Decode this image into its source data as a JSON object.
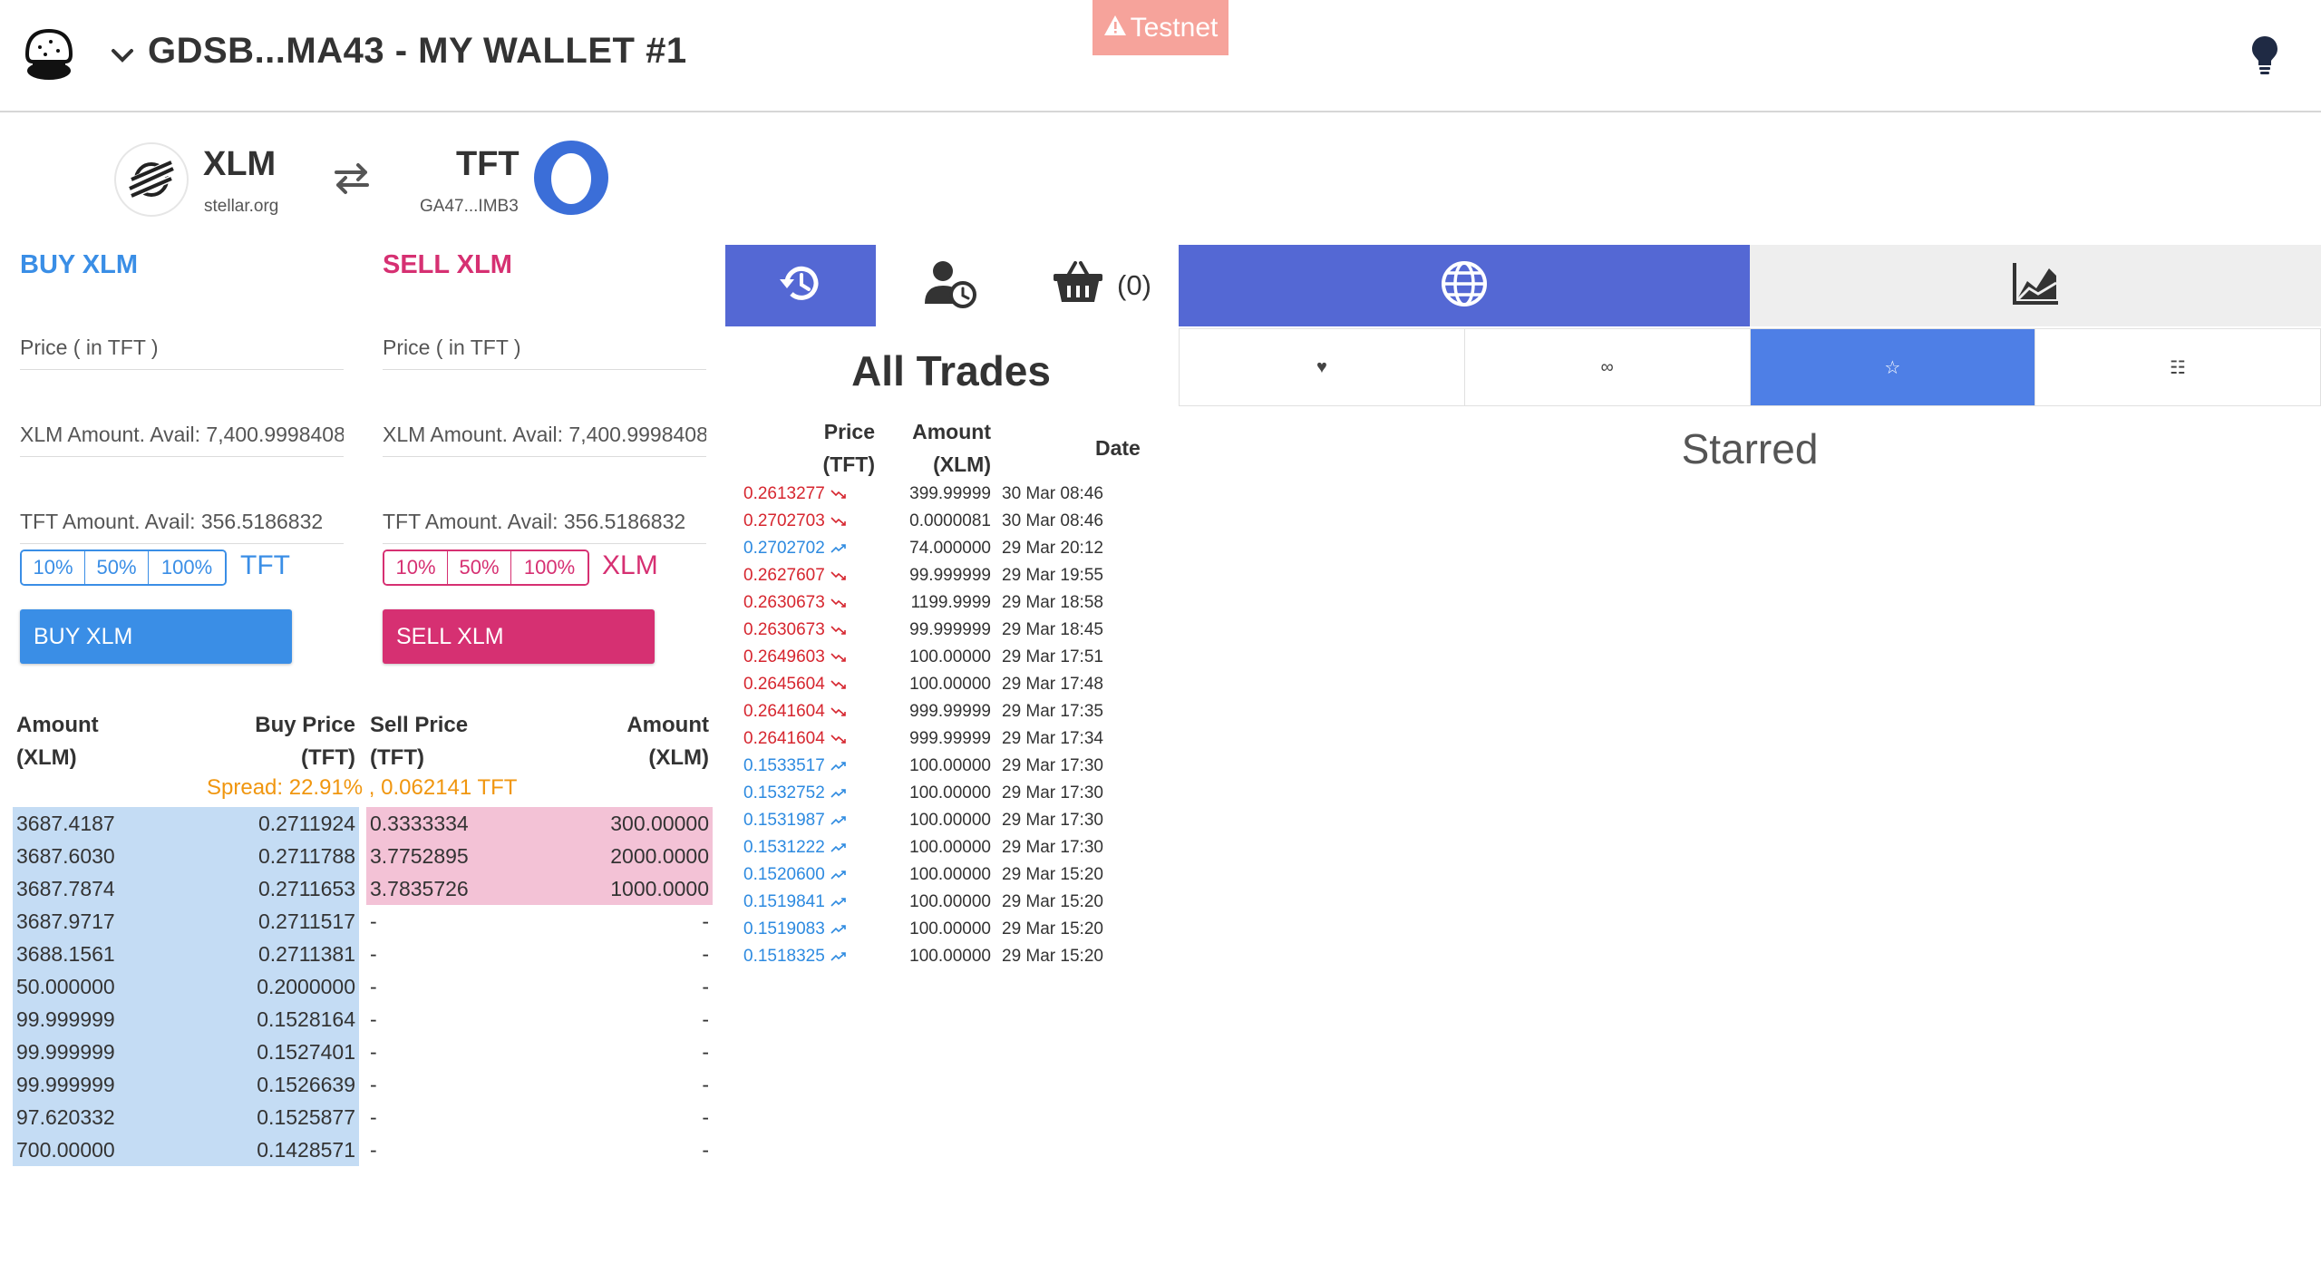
{
  "header": {
    "wallet_title": "GDSB...MA43 - MY WALLET #1",
    "testnet_label": "Testnet"
  },
  "pair": {
    "base": {
      "code": "XLM",
      "domain": "stellar.org"
    },
    "counter": {
      "code": "TFT",
      "issuer": "GA47...IMB3"
    }
  },
  "buy": {
    "title": "BUY XLM",
    "price_placeholder": "Price ( in TFT )",
    "amount_placeholder": "XLM Amount. Avail: 7,400.9998408",
    "total_placeholder": "TFT Amount. Avail: 356.5186832",
    "percent_options": [
      "10%",
      "50%",
      "100%"
    ],
    "percent_unit": "TFT",
    "button_label": "BUY XLM"
  },
  "sell": {
    "title": "SELL XLM",
    "price_placeholder": "Price ( in TFT )",
    "amount_placeholder": "XLM Amount. Avail: 7,400.9998408",
    "total_placeholder": "TFT Amount. Avail: 356.5186832",
    "percent_options": [
      "10%",
      "50%",
      "100%"
    ],
    "percent_unit": "XLM",
    "button_label": "SELL XLM"
  },
  "orderbook": {
    "headers": {
      "bid_amount": "Amount",
      "bid_amount_unit": "(XLM)",
      "bid_price": "Buy Price",
      "bid_price_unit": "(TFT)",
      "ask_price": "Sell Price",
      "ask_price_unit": "(TFT)",
      "ask_amount": "Amount",
      "ask_amount_unit": "(XLM)"
    },
    "spread": "Spread: 22.91% , 0.062141 TFT",
    "bids": [
      {
        "amount": "3687.4187",
        "price": "0.2711924"
      },
      {
        "amount": "3687.6030",
        "price": "0.2711788"
      },
      {
        "amount": "3687.7874",
        "price": "0.2711653"
      },
      {
        "amount": "3687.9717",
        "price": "0.2711517"
      },
      {
        "amount": "3688.1561",
        "price": "0.2711381"
      },
      {
        "amount": "50.000000",
        "price": "0.2000000"
      },
      {
        "amount": "99.999999",
        "price": "0.1528164"
      },
      {
        "amount": "99.999999",
        "price": "0.1527401"
      },
      {
        "amount": "99.999999",
        "price": "0.1526639"
      },
      {
        "amount": "97.620332",
        "price": "0.1525877"
      },
      {
        "amount": "700.00000",
        "price": "0.1428571"
      }
    ],
    "asks": [
      {
        "price": "0.3333334",
        "amount": "300.00000"
      },
      {
        "price": "3.7752895",
        "amount": "2000.0000"
      },
      {
        "price": "3.7835726",
        "amount": "1000.0000"
      },
      {
        "price": "-",
        "amount": "-"
      },
      {
        "price": "-",
        "amount": "-"
      },
      {
        "price": "-",
        "amount": "-"
      },
      {
        "price": "-",
        "amount": "-"
      },
      {
        "price": "-",
        "amount": "-"
      },
      {
        "price": "-",
        "amount": "-"
      },
      {
        "price": "-",
        "amount": "-"
      },
      {
        "price": "-",
        "amount": "-"
      }
    ]
  },
  "tabs": {
    "basket_count": "(0)"
  },
  "trades": {
    "title": "All Trades",
    "headers": {
      "price": "Price",
      "price_unit": "(TFT)",
      "amount": "Amount",
      "amount_unit": "(XLM)",
      "date": "Date"
    },
    "rows": [
      {
        "price": "0.2613277",
        "direction": "down",
        "amount": "399.99999",
        "date": "30 Mar 08:46"
      },
      {
        "price": "0.2702703",
        "direction": "down",
        "amount": "0.0000081",
        "date": "30 Mar 08:46"
      },
      {
        "price": "0.2702702",
        "direction": "up",
        "amount": "74.000000",
        "date": "29 Mar 20:12"
      },
      {
        "price": "0.2627607",
        "direction": "down",
        "amount": "99.999999",
        "date": "29 Mar 19:55"
      },
      {
        "price": "0.2630673",
        "direction": "down",
        "amount": "1199.9999",
        "date": "29 Mar 18:58"
      },
      {
        "price": "0.2630673",
        "direction": "down",
        "amount": "99.999999",
        "date": "29 Mar 18:45"
      },
      {
        "price": "0.2649603",
        "direction": "down",
        "amount": "100.00000",
        "date": "29 Mar 17:51"
      },
      {
        "price": "0.2645604",
        "direction": "down",
        "amount": "100.00000",
        "date": "29 Mar 17:48"
      },
      {
        "price": "0.2641604",
        "direction": "down",
        "amount": "999.99999",
        "date": "29 Mar 17:35"
      },
      {
        "price": "0.2641604",
        "direction": "down",
        "amount": "999.99999",
        "date": "29 Mar 17:34"
      },
      {
        "price": "0.1533517",
        "direction": "up",
        "amount": "100.00000",
        "date": "29 Mar 17:30"
      },
      {
        "price": "0.1532752",
        "direction": "up",
        "amount": "100.00000",
        "date": "29 Mar 17:30"
      },
      {
        "price": "0.1531987",
        "direction": "up",
        "amount": "100.00000",
        "date": "29 Mar 17:30"
      },
      {
        "price": "0.1531222",
        "direction": "up",
        "amount": "100.00000",
        "date": "29 Mar 17:30"
      },
      {
        "price": "0.1520600",
        "direction": "up",
        "amount": "100.00000",
        "date": "29 Mar 15:20"
      },
      {
        "price": "0.1519841",
        "direction": "up",
        "amount": "100.00000",
        "date": "29 Mar 15:20"
      },
      {
        "price": "0.1519083",
        "direction": "up",
        "amount": "100.00000",
        "date": "29 Mar 15:20"
      },
      {
        "price": "0.1518325",
        "direction": "up",
        "amount": "100.00000",
        "date": "29 Mar 15:20"
      }
    ]
  },
  "markets": {
    "filters": [
      {
        "icon": "heart-icon",
        "glyph": "♥",
        "active": false
      },
      {
        "icon": "infinity-icon",
        "glyph": "∞",
        "active": false
      },
      {
        "icon": "star-icon",
        "glyph": "☆",
        "active": true
      },
      {
        "icon": "sliders-icon",
        "glyph": "☷",
        "active": false
      }
    ],
    "active_filter_label": "Starred"
  },
  "colors": {
    "buy": "#3a8ee6",
    "sell": "#d63072",
    "tab_active": "#5468d4",
    "filter_active": "#4e7fe6",
    "spread": "#f0960f",
    "bid_bg": "#c4dcf4",
    "ask_bg": "#f3c2d6",
    "testnet_bg": "#f6a39b",
    "trade_down": "#d6262f",
    "trade_up": "#2d8ae0"
  }
}
